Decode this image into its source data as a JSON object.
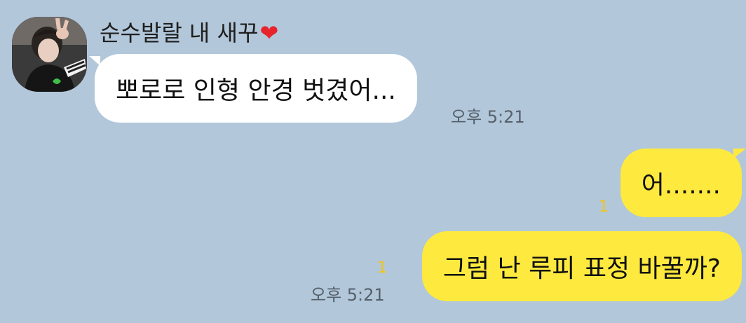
{
  "chat": {
    "sender": {
      "name": "순수발랄 내 새꾸",
      "heart": "❤"
    },
    "messages": [
      {
        "direction": "incoming",
        "text": "뽀로로 인형 안경 벗겼어...",
        "time": "오후 5:21"
      },
      {
        "direction": "outgoing",
        "text": "어.......",
        "unread": "1"
      },
      {
        "direction": "outgoing",
        "text": "그럼 난 루피 표정 바꿀까?",
        "unread": "1",
        "time": "오후 5:21"
      }
    ]
  },
  "colors": {
    "background": "#b2c7da",
    "incoming_bubble": "#ffffff",
    "outgoing_bubble": "#fee93f",
    "unread_count": "#f2c511",
    "timestamp": "#55606b"
  }
}
